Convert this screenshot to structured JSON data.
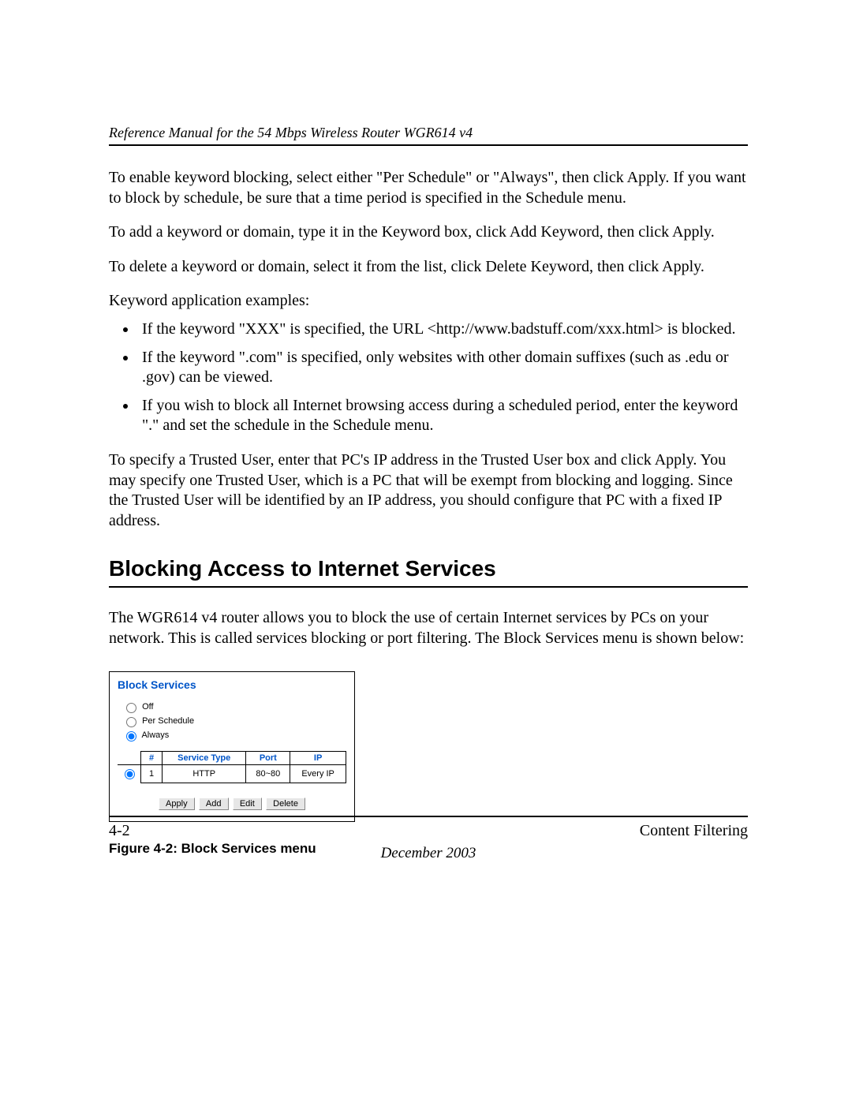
{
  "header": {
    "running_title": "Reference Manual for the 54 Mbps Wireless Router WGR614 v4"
  },
  "paragraphs": {
    "p1": "To enable keyword blocking, select either \"Per Schedule\" or \"Always\", then click Apply. If you want to block by schedule, be sure that a time period is specified in the Schedule menu.",
    "p2": "To add a keyword or domain, type it in the Keyword box, click Add Keyword, then click Apply.",
    "p3": "To delete a keyword or domain, select it from the list, click Delete Keyword, then click Apply.",
    "p4": "Keyword application examples:",
    "p5": "To specify a Trusted User, enter that PC's IP address in the Trusted User box and click Apply. You may specify one Trusted User, which is a PC that will be exempt from blocking and logging. Since the Trusted User will be identified by an IP address, you should configure that PC with a fixed IP address.",
    "p6": "The WGR614 v4 router allows you to block the use of certain Internet services by PCs on your network. This is called services blocking or port filtering. The Block Services menu is shown below:"
  },
  "bullets": [
    "If the keyword \"XXX\" is specified, the URL <http://www.badstuff.com/xxx.html> is blocked.",
    "If the keyword \".com\" is specified, only websites with other domain suffixes (such as .edu or .gov) can be viewed.",
    "If you wish to block all Internet browsing access during a scheduled period, enter the keyword \".\" and set the schedule in the Schedule menu."
  ],
  "section_heading": "Blocking Access to Internet Services",
  "figure": {
    "panel_title": "Block Services",
    "radios": {
      "off": "Off",
      "per_schedule": "Per Schedule",
      "always": "Always"
    },
    "table": {
      "headers": {
        "num": "#",
        "service_type": "Service Type",
        "port": "Port",
        "ip": "IP"
      },
      "row": {
        "num": "1",
        "service_type": "HTTP",
        "port": "80~80",
        "ip": "Every IP"
      }
    },
    "buttons": {
      "apply": "Apply",
      "add": "Add",
      "edit": "Edit",
      "delete": "Delete"
    },
    "caption": "Figure 4-2:  Block Services menu"
  },
  "footer": {
    "page_number": "4-2",
    "chapter": "Content Filtering",
    "date": "December 2003"
  }
}
